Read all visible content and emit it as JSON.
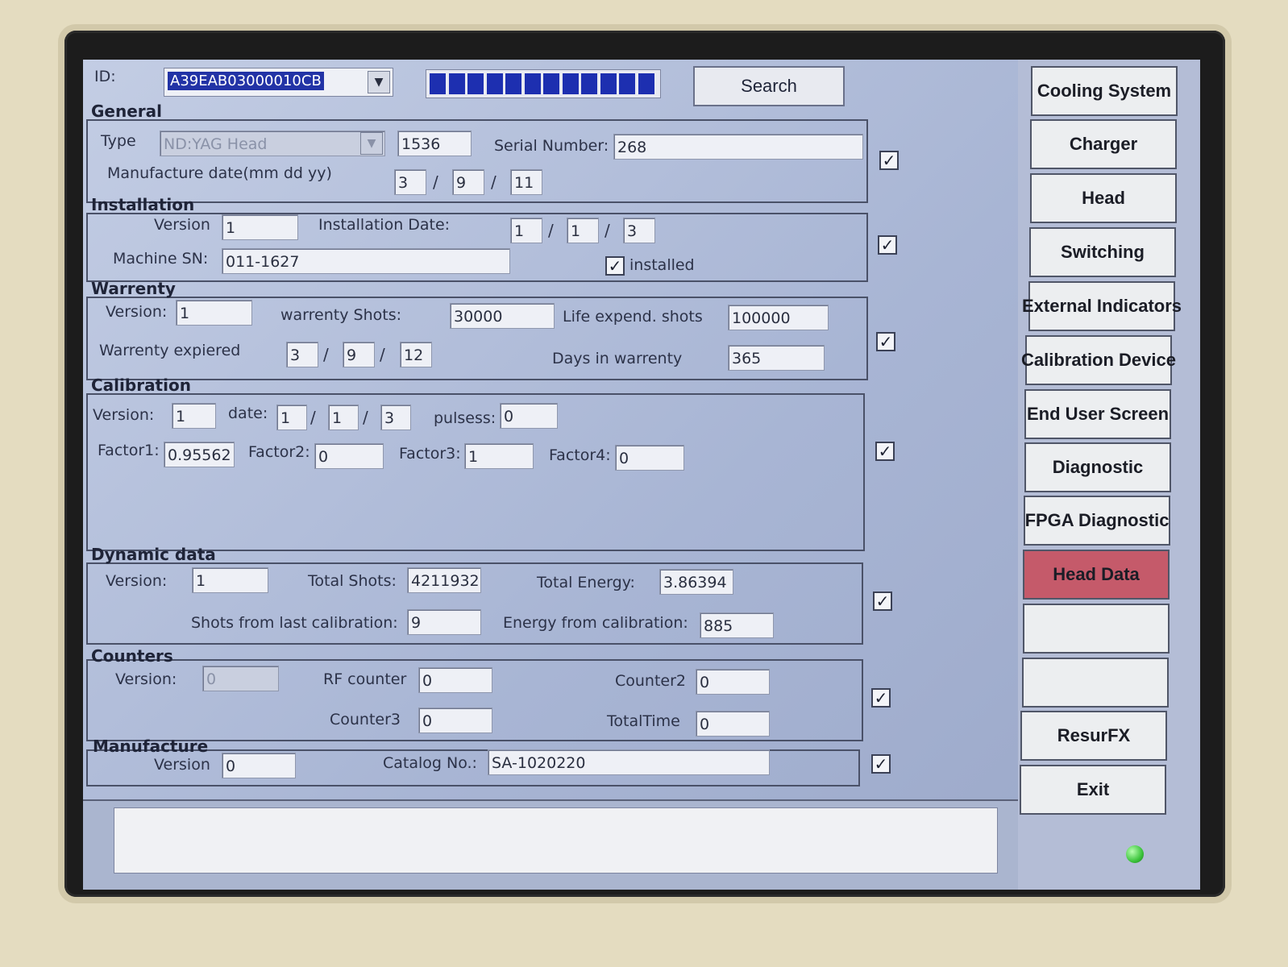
{
  "header": {
    "id_label": "ID:",
    "id_value": "A39EAB03000010CB",
    "search_label": "Search"
  },
  "progress": {
    "segments": 12
  },
  "general": {
    "title": "General",
    "type_label": "Type",
    "type_value": "ND:YAG Head",
    "code": "1536",
    "serial_label": "Serial Number:",
    "serial_value": "268",
    "mfg_label": "Manufacture date(mm dd yy)",
    "mfg_mm": "3",
    "mfg_dd": "9",
    "mfg_yy": "11",
    "checked": "✓"
  },
  "installation": {
    "title": "Installation",
    "version_label": "Version",
    "version_value": "1",
    "date_label": "Installation Date:",
    "date_mm": "1",
    "date_dd": "1",
    "date_yy": "3",
    "machine_sn_label": "Machine SN:",
    "machine_sn_value": "011-1627",
    "installed_label": "installed",
    "installed_check": "✓",
    "checked": "✓"
  },
  "warrenty": {
    "title": "Warrenty",
    "version_label": "Version:",
    "version_value": "1",
    "shots_label": "warrenty Shots:",
    "shots_value": "30000",
    "life_label": "Life expend. shots",
    "life_value": "100000",
    "expired_label": "Warrenty expiered",
    "exp_mm": "3",
    "exp_dd": "9",
    "exp_yy": "12",
    "days_label": "Days in warrenty",
    "days_value": "365",
    "checked": "✓"
  },
  "calibration": {
    "title": "Calibration",
    "version_label": "Version:",
    "version_value": "1",
    "date_label": "date:",
    "date_mm": "1",
    "date_dd": "1",
    "date_yy": "3",
    "pulses_label": "pulsess:",
    "pulses_value": "0",
    "factor1_label": "Factor1:",
    "factor1_value": "0.95562",
    "factor2_label": "Factor2:",
    "factor2_value": "0",
    "factor3_label": "Factor3:",
    "factor3_value": "1",
    "factor4_label": "Factor4:",
    "factor4_value": "0",
    "checked": "✓"
  },
  "dynamic": {
    "title": "Dynamic data",
    "version_label": "Version:",
    "version_value": "1",
    "total_shots_label": "Total Shots:",
    "total_shots_value": "4211932",
    "total_energy_label": "Total Energy:",
    "total_energy_value": "3.86394",
    "shots_cal_label": "Shots from last calibration:",
    "shots_cal_value": "9",
    "energy_cal_label": "Energy from calibration:",
    "energy_cal_value": "885",
    "checked": "✓"
  },
  "counters": {
    "title": "Counters",
    "version_label": "Version:",
    "version_value": "0",
    "rf_label": "RF counter",
    "rf_value": "0",
    "counter2_label": "Counter2",
    "counter2_value": "0",
    "counter3_label": "Counter3",
    "counter3_value": "0",
    "totaltime_label": "TotalTime",
    "totaltime_value": "0",
    "checked": "✓"
  },
  "manufacture": {
    "title": "Manufacture",
    "version_label": "Version",
    "version_value": "0",
    "catalog_label": "Catalog No.:",
    "catalog_value": "SA-1020220",
    "checked": "✓"
  },
  "nav": {
    "items": [
      {
        "label": "Cooling System"
      },
      {
        "label": "Charger"
      },
      {
        "label": "Head"
      },
      {
        "label": "Switching"
      },
      {
        "label": "External Indicators"
      },
      {
        "label": "Calibration Device"
      },
      {
        "label": "End User Screen"
      },
      {
        "label": "Diagnostic"
      },
      {
        "label": "FPGA Diagnostic"
      },
      {
        "label": "Head Data"
      },
      {
        "label": ""
      },
      {
        "label": ""
      },
      {
        "label": "ResurFX"
      },
      {
        "label": "Exit"
      }
    ],
    "active_index": 9
  },
  "colors": {
    "active_nav": "#c55a6a",
    "progress": "#1d2fb0",
    "status_led": "#3cc43c"
  }
}
